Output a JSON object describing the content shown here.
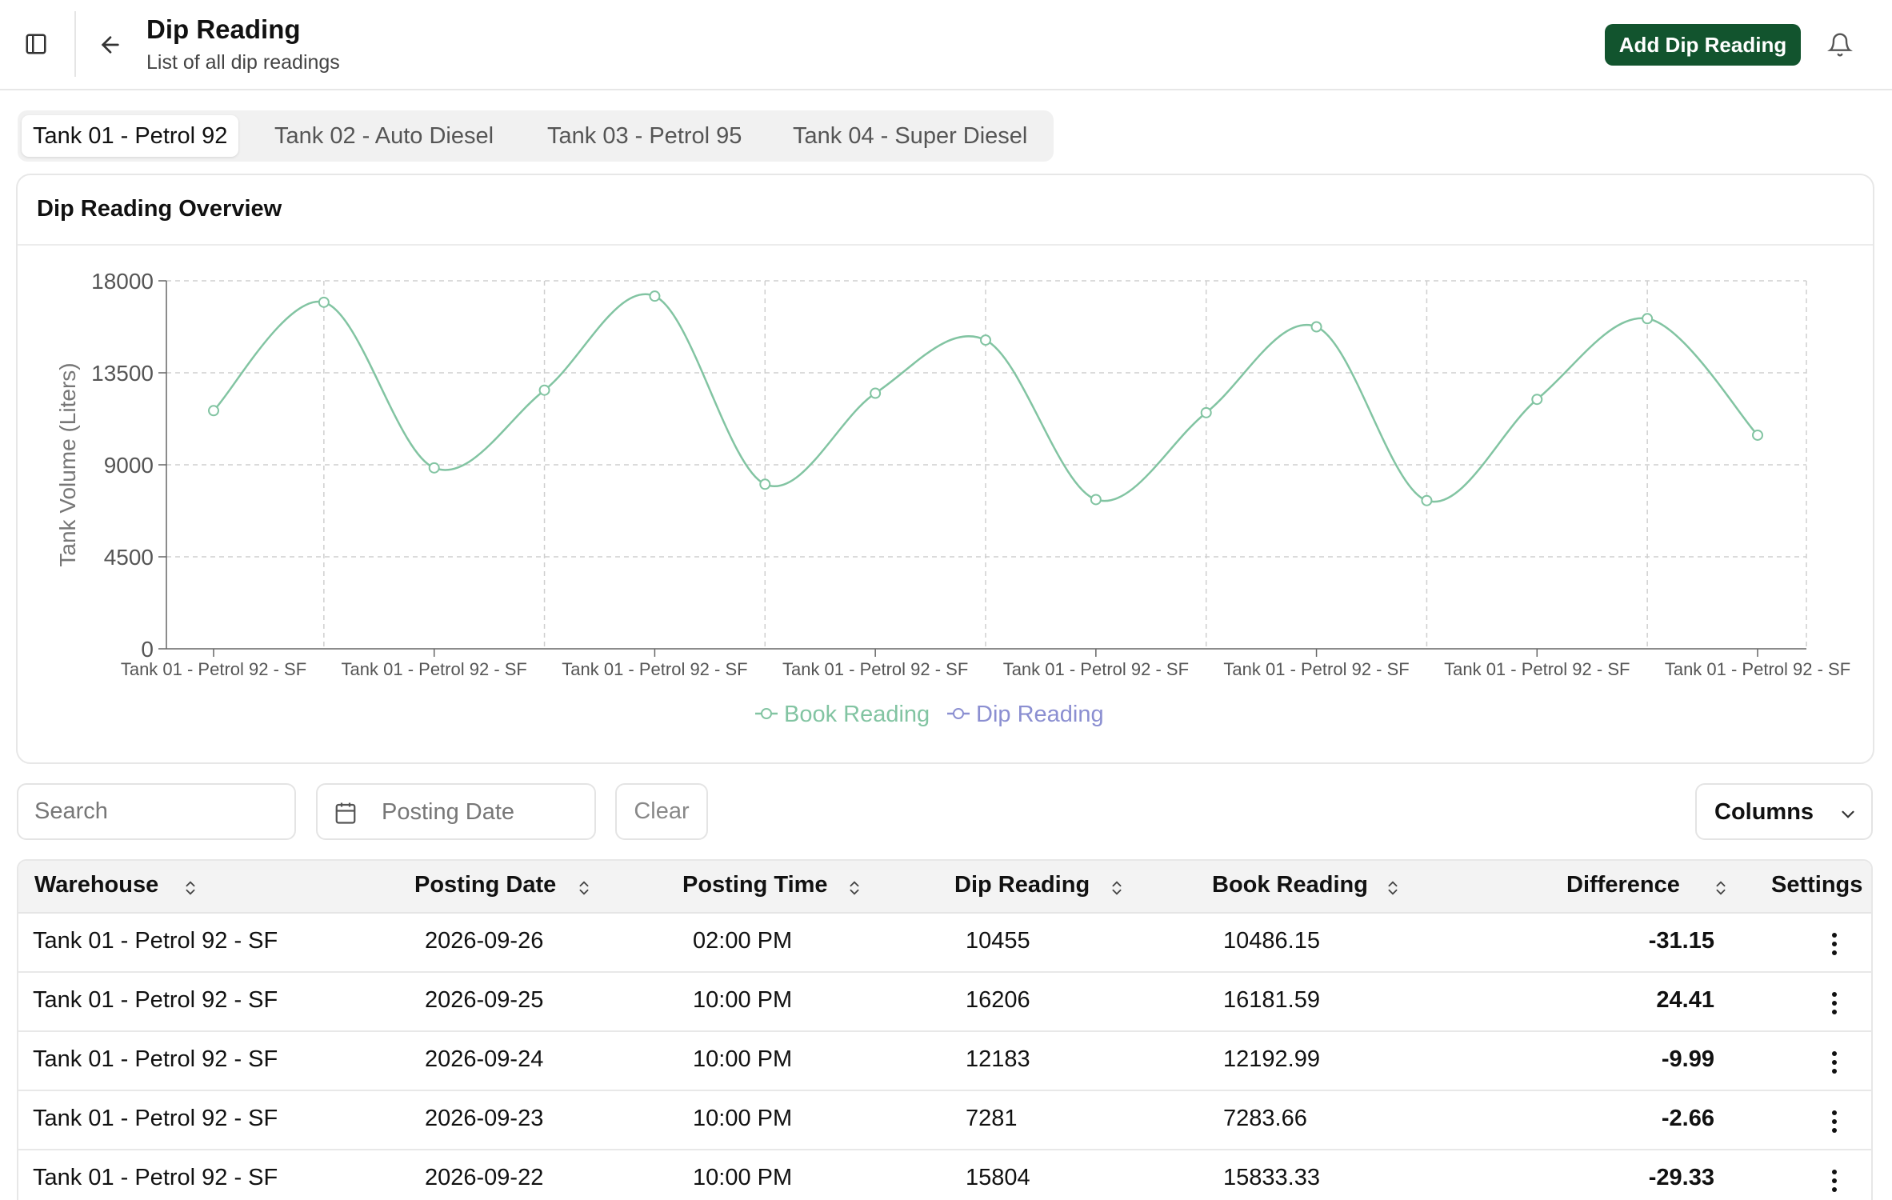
{
  "header": {
    "title": "Dip Reading",
    "subtitle": "List of all dip readings",
    "add_button": "Add Dip Reading",
    "icons": {
      "sidebar": "sidebar-panel-icon",
      "back": "arrow-left-icon",
      "notifications": "bell-icon"
    }
  },
  "tabs": [
    {
      "label": "Tank 01 - Petrol 92",
      "active": true
    },
    {
      "label": "Tank 02 - Auto Diesel",
      "active": false
    },
    {
      "label": "Tank 03 - Petrol 95",
      "active": false
    },
    {
      "label": "Tank 04 - Super Diesel",
      "active": false
    }
  ],
  "chart_card": {
    "title": "Dip Reading Overview"
  },
  "chart_data": {
    "type": "line",
    "ylabel": "Tank Volume (Liters)",
    "ylim": [
      0,
      18000
    ],
    "yticks": [
      0,
      4500,
      9000,
      13500,
      18000
    ],
    "xtick_labels": [
      "Tank 01 - Petrol 92 - SF",
      "Tank 01 - Petrol 92 - SF",
      "Tank 01 - Petrol 92 - SF",
      "Tank 01 - Petrol 92 - SF",
      "Tank 01 - Petrol 92 - SF",
      "Tank 01 - Petrol 92 - SF",
      "Tank 01 - Petrol 92 - SF",
      "Tank 01 - Petrol 92 - SF"
    ],
    "grid": true,
    "legend_position": "bottom",
    "series": [
      {
        "name": "Book Reading",
        "color": "#82c4a2",
        "values": [
          11650,
          16950,
          8850,
          12650,
          17250,
          8050,
          12500,
          15100,
          7300,
          11550,
          15750,
          7250,
          12200,
          16150,
          10450
        ]
      },
      {
        "name": "Dip Reading",
        "color": "#8b8fd1",
        "values": []
      }
    ]
  },
  "filters": {
    "search_placeholder": "Search",
    "posting_date_label": "Posting Date",
    "clear_label": "Clear",
    "columns_label": "Columns"
  },
  "table": {
    "headers": {
      "warehouse": "Warehouse",
      "posting_date": "Posting Date",
      "posting_time": "Posting Time",
      "dip_reading": "Dip Reading",
      "book_reading": "Book Reading",
      "difference": "Difference",
      "settings": "Settings"
    },
    "rows": [
      {
        "warehouse": "Tank 01 - Petrol 92 - SF",
        "posting_date": "2026-09-26",
        "posting_time": "02:00 PM",
        "dip_reading": "10455",
        "book_reading": "10486.15",
        "difference": "-31.15"
      },
      {
        "warehouse": "Tank 01 - Petrol 92 - SF",
        "posting_date": "2026-09-25",
        "posting_time": "10:00 PM",
        "dip_reading": "16206",
        "book_reading": "16181.59",
        "difference": "24.41"
      },
      {
        "warehouse": "Tank 01 - Petrol 92 - SF",
        "posting_date": "2026-09-24",
        "posting_time": "10:00 PM",
        "dip_reading": "12183",
        "book_reading": "12192.99",
        "difference": "-9.99"
      },
      {
        "warehouse": "Tank 01 - Petrol 92 - SF",
        "posting_date": "2026-09-23",
        "posting_time": "10:00 PM",
        "dip_reading": "7281",
        "book_reading": "7283.66",
        "difference": "-2.66"
      },
      {
        "warehouse": "Tank 01 - Petrol 92 - SF",
        "posting_date": "2026-09-22",
        "posting_time": "10:00 PM",
        "dip_reading": "15804",
        "book_reading": "15833.33",
        "difference": "-29.33"
      }
    ]
  },
  "colors": {
    "primary": "#12542e",
    "book_series": "#82c4a2",
    "dip_series": "#8b8fd1"
  }
}
